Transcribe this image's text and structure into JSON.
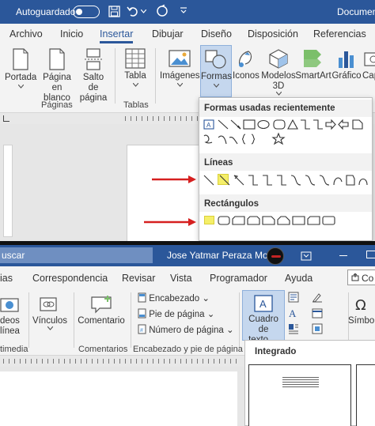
{
  "top_window": {
    "autosave_label": "Autoguardado",
    "autosave_state": "off",
    "doc_title": "Document",
    "tabs": [
      "Archivo",
      "Inicio",
      "Insertar",
      "Dibujar",
      "Diseño",
      "Disposición",
      "Referencias"
    ],
    "active_tab": "Insertar",
    "ribbon": {
      "portada": "Portada",
      "pagina_en_blanco_1": "Página",
      "pagina_en_blanco_2": "en blanco",
      "salto_1": "Salto de",
      "salto_2": "página",
      "tabla": "Tabla",
      "imagenes": "Imágenes",
      "formas": "Formas",
      "iconos": "Iconos",
      "modelos_1": "Modelos",
      "modelos_2": "3D",
      "smartart": "SmartArt",
      "grafico": "Gráfico",
      "captura": "Cap",
      "group_paginas": "Páginas",
      "group_tablas": "Tablas"
    },
    "dropdown": {
      "recent_title": "Formas usadas recientemente",
      "lines_title": "Líneas",
      "rect_title": "Rectángulos"
    }
  },
  "bottom_window": {
    "search_text": "uscar",
    "user_name": "Jose Yatmar Peraza Mora",
    "tabs": [
      "ias",
      "Correspondencia",
      "Revisar",
      "Vista",
      "Programador",
      "Ayuda"
    ],
    "share_label": "Co",
    "ribbon": {
      "videos_1": "deos",
      "videos_2": "línea",
      "vinculos": "Vínculos",
      "comentario": "Comentario",
      "encabezado": "Encabezado",
      "pie": "Pie de página",
      "numero": "Número de página",
      "cuadro_1": "Cuadro de",
      "cuadro_2": "texto",
      "simbolos": "Símbolo",
      "group_multimedia": "timedia",
      "group_comentarios": "Comentarios",
      "group_encabezado": "Encabezado y pie de página"
    },
    "panel_title": "Integrado"
  },
  "colors": {
    "title_bar": "#2b579a",
    "arrow": "#d62020",
    "highlight": "#f5ef68"
  }
}
